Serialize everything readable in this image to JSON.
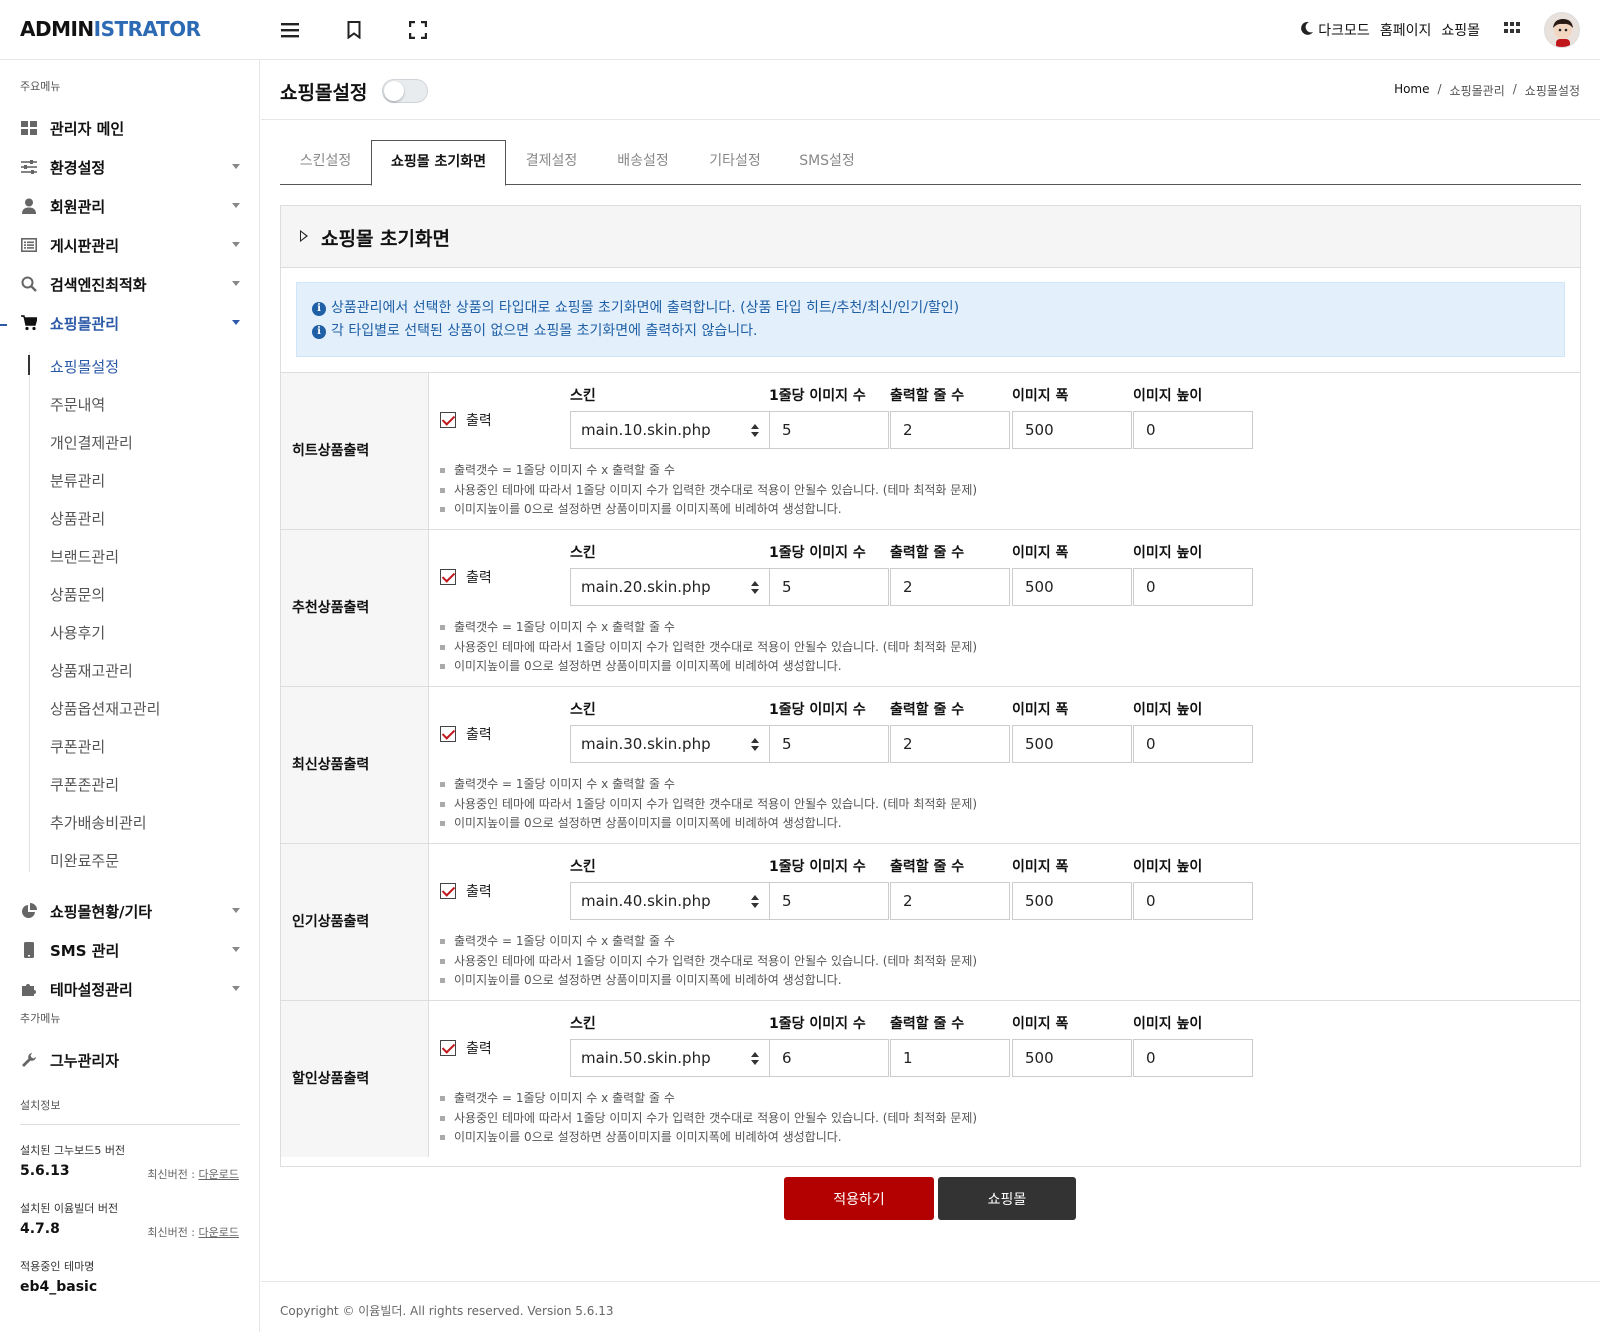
{
  "header": {
    "logo_part1": "ADMIN",
    "logo_part2": "ISTRATOR",
    "darkmode_label": "다크모드",
    "homepage_label": "홈페이지",
    "shop_label": "쇼핑몰"
  },
  "sidebar": {
    "main_section": "주요메뉴",
    "menu": [
      {
        "label": "관리자 메인",
        "icon": "dashboard-icon"
      },
      {
        "label": "환경설정",
        "icon": "sliders-icon"
      },
      {
        "label": "회원관리",
        "icon": "user-icon"
      },
      {
        "label": "게시판관리",
        "icon": "list-icon"
      },
      {
        "label": "검색엔진최적화",
        "icon": "search-icon"
      },
      {
        "label": "쇼핑몰관리",
        "icon": "cart-icon"
      }
    ],
    "submenu": [
      "쇼핑몰설정",
      "주문내역",
      "개인결제관리",
      "분류관리",
      "상품관리",
      "브랜드관리",
      "상품문의",
      "사용후기",
      "상품재고관리",
      "상품옵션재고관리",
      "쿠폰관리",
      "쿠폰존관리",
      "추가배송비관리",
      "미완료주문"
    ],
    "menu2": [
      {
        "label": "쇼핑몰현황/기타",
        "icon": "pie-chart-icon"
      },
      {
        "label": "SMS 관리",
        "icon": "phone-icon"
      },
      {
        "label": "테마설정관리",
        "icon": "puzzle-icon"
      }
    ],
    "extra_section": "추가메뉴",
    "extra_item": "그누관리자",
    "install_section": "설치정보",
    "gnuboard_label": "설치된 그누보드5 버전",
    "gnuboard_version": "5.6.13",
    "eyoom_label": "설치된 이윰빌더 버전",
    "eyoom_version": "4.7.8",
    "latest_label": "최신버전 :",
    "download_label": "다운로드",
    "theme_label": "적용중인 테마명",
    "theme_name": "eb4_basic"
  },
  "page": {
    "title": "쇼핑몰설정",
    "breadcrumb": [
      "Home",
      "쇼핑몰관리",
      "쇼핑몰설정"
    ],
    "tabs": [
      "스킨설정",
      "쇼핑몰 초기화면",
      "결제설정",
      "배송설정",
      "기타설정",
      "SMS설정"
    ],
    "active_tab": 1,
    "panel_title": "쇼핑몰 초기화면",
    "alert": [
      "상품관리에서 선택한 상품의 타입대로 쇼핑몰 초기화면에 출력합니다. (상품 타입 히트/추천/최신/인기/할인)",
      "각 타입별로 선택된 상품이 없으면 쇼핑몰 초기화면에 출력하지 않습니다."
    ],
    "columns": {
      "skin": "스킨",
      "per_row": "1줄당 이미지 수",
      "rows": "출력할 줄 수",
      "width": "이미지 폭",
      "height": "이미지 높이"
    },
    "checkbox_label": "출력",
    "notes": [
      "출력갯수 = 1줄당 이미지 수 x 출력할 줄 수",
      "사용중인 테마에 따라서 1줄당 이미지 수가 입력한 갯수대로 적용이 안될수 있습니다. (테마 최적화 문제)",
      "이미지높이를 0으로 설정하면 상품이미지를 이미지폭에 비례하여 생성합니다."
    ],
    "rows": [
      {
        "label": "히트상품출력",
        "checked": true,
        "skin": "main.10.skin.php",
        "per_row": "5",
        "rows": "2",
        "width": "500",
        "height": "0"
      },
      {
        "label": "추천상품출력",
        "checked": true,
        "skin": "main.20.skin.php",
        "per_row": "5",
        "rows": "2",
        "width": "500",
        "height": "0"
      },
      {
        "label": "최신상품출력",
        "checked": true,
        "skin": "main.30.skin.php",
        "per_row": "5",
        "rows": "2",
        "width": "500",
        "height": "0"
      },
      {
        "label": "인기상품출력",
        "checked": true,
        "skin": "main.40.skin.php",
        "per_row": "5",
        "rows": "2",
        "width": "500",
        "height": "0"
      },
      {
        "label": "할인상품출력",
        "checked": true,
        "skin": "main.50.skin.php",
        "per_row": "6",
        "rows": "1",
        "width": "500",
        "height": "0"
      }
    ],
    "apply_button": "적용하기",
    "shop_button": "쇼핑몰",
    "footer": "Copyright © 이윰빌더. All rights reserved. Version 5.6.13"
  },
  "colors": {
    "accent": "#2d6ab4",
    "apply": "#b30000",
    "dark_button": "#333333",
    "alert_bg": "#e3f0fb"
  }
}
